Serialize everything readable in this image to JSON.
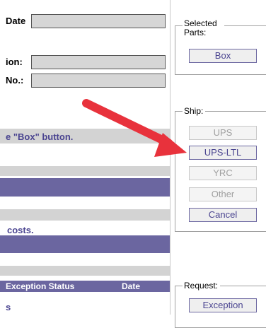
{
  "form": {
    "date_label": "Date",
    "location_label": "ion:",
    "number_label": "No.:",
    "instruction": "e \"Box\" button.",
    "costs_text": "costs.",
    "table_header": {
      "exception_status": "Exception Status",
      "date": "Date"
    },
    "bottom_fragment": "s"
  },
  "selected_parts": {
    "legend": "Selected Parts:",
    "box_button": "Box"
  },
  "ship": {
    "legend": "Ship:",
    "buttons": [
      {
        "label": "UPS",
        "enabled": false
      },
      {
        "label": "UPS-LTL",
        "enabled": true
      },
      {
        "label": "YRC",
        "enabled": false
      },
      {
        "label": "Other",
        "enabled": false
      },
      {
        "label": "Cancel",
        "enabled": true
      }
    ]
  },
  "request": {
    "legend": "Request:",
    "exception_button": "Exception"
  },
  "colors": {
    "band_purple": "#6b66a0",
    "band_gray": "#d3d3d3",
    "text_purple": "#4a4490",
    "arrow_red": "#e8323c"
  }
}
